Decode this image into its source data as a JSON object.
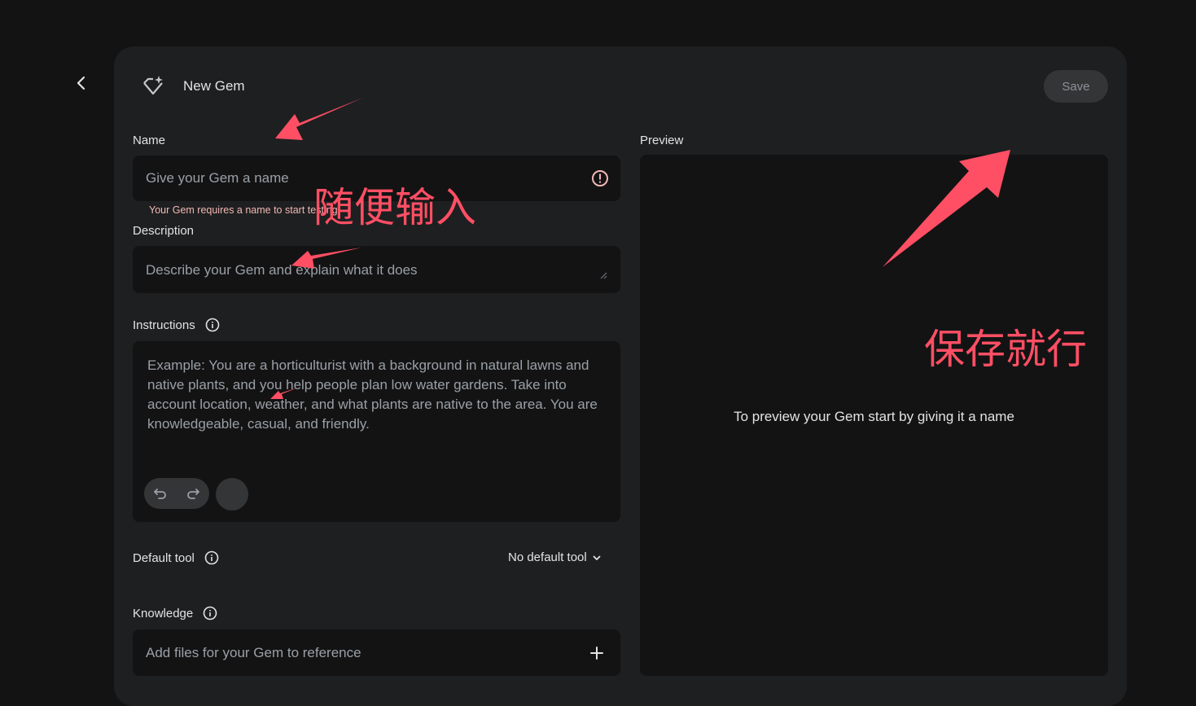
{
  "header": {
    "title": "New Gem",
    "save_label": "Save"
  },
  "name_field": {
    "label": "Name",
    "placeholder": "Give your Gem a name",
    "error": "Your Gem requires a name to start testing"
  },
  "description_field": {
    "label": "Description",
    "placeholder": "Describe your Gem and explain what it does"
  },
  "instructions_field": {
    "label": "Instructions",
    "placeholder": "Example: You are a horticulturist with a background in natural lawns and native plants, and you help people plan low water gardens. Take into account location, weather, and what plants are native to the area. You are knowledgeable, casual, and friendly."
  },
  "default_tool": {
    "label": "Default tool",
    "value": "No default tool"
  },
  "knowledge": {
    "label": "Knowledge",
    "placeholder": "Add files for your Gem to reference"
  },
  "preview": {
    "label": "Preview",
    "message": "To preview your Gem start by giving it a name"
  },
  "annotations": {
    "input_hint": "随便输入",
    "save_hint": "保存就行"
  },
  "colors": {
    "background": "#131314",
    "panel": "#1e1f20",
    "annotation": "#ff4f64",
    "error": "#f2b8b5"
  },
  "icons": [
    "chevron-left-icon",
    "gem-sparkle-icon",
    "error-icon",
    "info-icon",
    "undo-icon",
    "redo-icon",
    "chevron-down-icon",
    "plus-icon"
  ]
}
